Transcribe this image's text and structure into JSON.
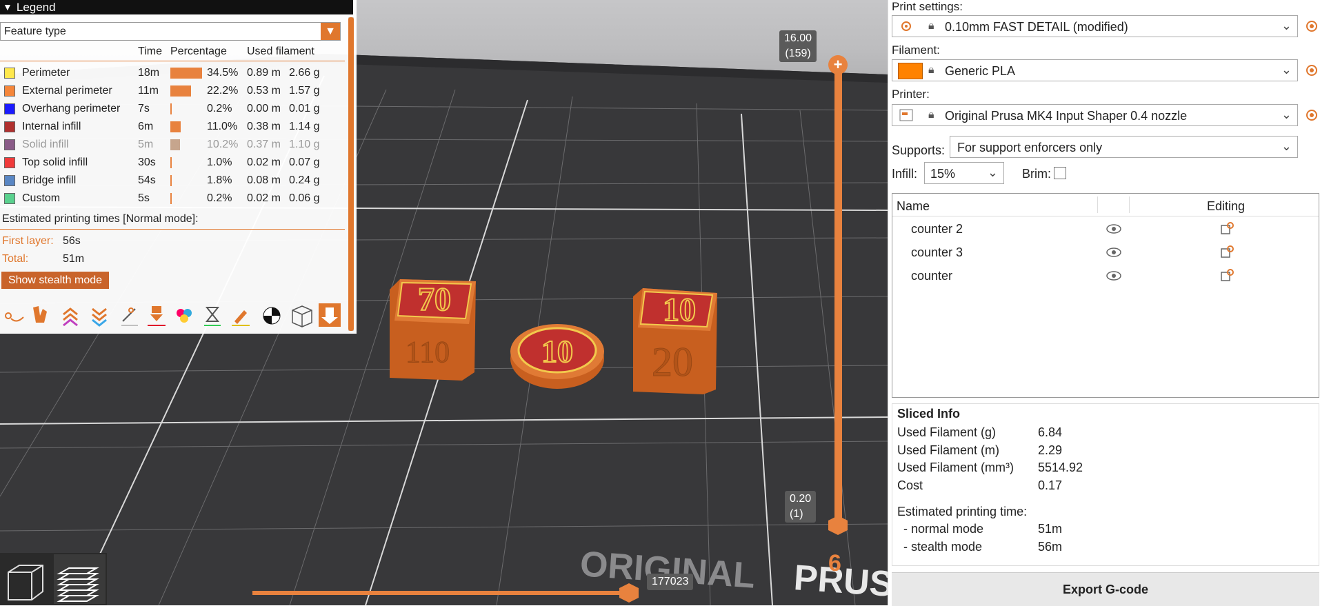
{
  "legend": {
    "title": "Legend",
    "feature_type": "Feature type",
    "headers": {
      "time": "Time",
      "percentage": "Percentage",
      "used_filament": "Used filament"
    },
    "rows": [
      {
        "name": "Perimeter",
        "color": "#ffe84d",
        "time": "18m",
        "pct": "34.5%",
        "m": "0.89 m",
        "g": "2.66 g",
        "share": 0.345,
        "dim": false
      },
      {
        "name": "External perimeter",
        "color": "#f5863a",
        "time": "11m",
        "pct": "22.2%",
        "m": "0.53 m",
        "g": "1.57 g",
        "share": 0.222,
        "dim": false
      },
      {
        "name": "Overhang perimeter",
        "color": "#1a1aff",
        "time": "7s",
        "pct": "0.2%",
        "m": "0.00 m",
        "g": "0.01 g",
        "share": 0.002,
        "dim": false
      },
      {
        "name": "Internal infill",
        "color": "#b0302e",
        "time": "6m",
        "pct": "11.0%",
        "m": "0.38 m",
        "g": "1.14 g",
        "share": 0.11,
        "dim": false
      },
      {
        "name": "Solid infill",
        "color": "#8a5b88",
        "time": "5m",
        "pct": "10.2%",
        "m": "0.37 m",
        "g": "1.10 g",
        "share": 0.102,
        "dim": true
      },
      {
        "name": "Top solid infill",
        "color": "#f03a3a",
        "time": "30s",
        "pct": "1.0%",
        "m": "0.02 m",
        "g": "0.07 g",
        "share": 0.01,
        "dim": false
      },
      {
        "name": "Bridge infill",
        "color": "#5a87c4",
        "time": "54s",
        "pct": "1.8%",
        "m": "0.08 m",
        "g": "0.24 g",
        "share": 0.018,
        "dim": false
      },
      {
        "name": "Custom",
        "color": "#5ad18e",
        "time": "5s",
        "pct": "0.2%",
        "m": "0.02 m",
        "g": "0.06 g",
        "share": 0.002,
        "dim": false
      }
    ],
    "estimated_title": "Estimated printing times [Normal mode]:",
    "first_layer_label": "First layer:",
    "first_layer_value": "56s",
    "total_label": "Total:",
    "total_value": "51m",
    "stealth_button": "Show stealth mode"
  },
  "viewport": {
    "top_tag_height": "16.00",
    "top_tag_layer": "(159)",
    "bottom_tag_height": "0.20",
    "bottom_tag_layer": "(1)",
    "move_tag": "177023",
    "layer_indicator": "6",
    "bed_text_left": "ORIGINAL",
    "bed_text_right": "PRUS",
    "models": [
      {
        "top_number": "70",
        "side_number": "110"
      },
      {
        "top_number": "10"
      },
      {
        "top_number": "10",
        "side_number": "20"
      }
    ]
  },
  "sidebar": {
    "print_settings_label": "Print settings:",
    "print_settings_value": "0.10mm FAST DETAIL (modified)",
    "filament_label": "Filament:",
    "filament_value": "Generic PLA",
    "filament_color": "#ff8200",
    "printer_label": "Printer:",
    "printer_value": "Original Prusa MK4 Input Shaper 0.4 nozzle",
    "supports_label": "Supports:",
    "supports_value": "For support enforcers only",
    "infill_label": "Infill:",
    "infill_value": "15%",
    "brim_label": "Brim:",
    "object_list": {
      "name_header": "Name",
      "editing_header": "Editing",
      "objects": [
        "counter 2",
        "counter 3",
        "counter"
      ]
    },
    "sliced_info": {
      "title": "Sliced Info",
      "rows": [
        {
          "label": "Used Filament (g)",
          "value": "6.84"
        },
        {
          "label": "Used Filament (m)",
          "value": "2.29"
        },
        {
          "label": "Used Filament (mm³)",
          "value": "5514.92"
        },
        {
          "label": "Cost",
          "value": "0.17"
        }
      ],
      "estimated_label": "Estimated printing time:",
      "normal_label": "- normal mode",
      "normal_value": "51m",
      "stealth_label": "- stealth mode",
      "stealth_value": "56m"
    },
    "export_button": "Export G-code"
  },
  "colors": {
    "accent": "#e8823e",
    "bed": "#3a3a3c"
  }
}
